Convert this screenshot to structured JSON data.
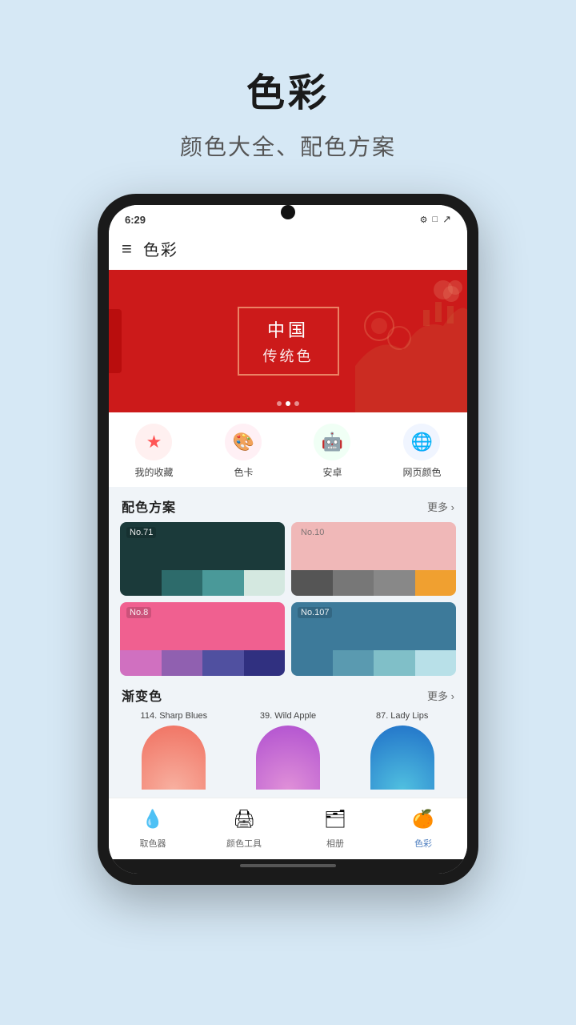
{
  "page": {
    "bg_color": "#d6e8f5",
    "main_title": "色彩",
    "subtitle": "颜色大全、配色方案"
  },
  "status_bar": {
    "time": "6:29",
    "icons": [
      "⚙",
      "□",
      "↗"
    ]
  },
  "nav": {
    "menu_icon": "≡",
    "title": "色彩"
  },
  "banner": {
    "title": "中国",
    "subtitle": "传统色",
    "dots": [
      false,
      true,
      false
    ]
  },
  "quick_items": [
    {
      "id": "favorites",
      "icon": "★",
      "icon_color": "#ff6b6b",
      "bg": "#fff0f0",
      "label": "我的收藏"
    },
    {
      "id": "color-card",
      "icon": "🎨",
      "icon_color": "#e05",
      "bg": "#fff0f5",
      "label": "色卡"
    },
    {
      "id": "android",
      "icon": "🤖",
      "icon_color": "#3ddc84",
      "bg": "#f0fff5",
      "label": "安卓"
    },
    {
      "id": "web-colors",
      "icon": "🌐",
      "icon_color": "#4285f4",
      "bg": "#f0f5ff",
      "label": "网页颜色"
    }
  ],
  "palette_section": {
    "title": "配色方案",
    "more_label": "更多",
    "palettes": [
      {
        "no": "No.71",
        "no_dark": false,
        "top_color": "#1b3a3a",
        "swatches": [
          "#1b3a3a",
          "#2d6b6b",
          "#4a9999",
          "#d4e8e0"
        ]
      },
      {
        "no": "No.10",
        "no_dark": true,
        "top_color": "#f0b8b8",
        "swatches": [
          "#555",
          "#777",
          "#888",
          "#f0a030"
        ]
      },
      {
        "no": "No.8",
        "no_dark": false,
        "top_color": "#f06090",
        "swatches": [
          "#d070c0",
          "#9060b0",
          "#5050a0",
          "#303080"
        ]
      },
      {
        "no": "No.107",
        "no_dark": false,
        "top_color": "#3d7a9a",
        "swatches": [
          "#3d7a9a",
          "#5a9ab0",
          "#80bfc8",
          "#b8e0e8"
        ]
      }
    ]
  },
  "gradient_section": {
    "title": "渐变色",
    "more_label": "更多",
    "gradients": [
      {
        "id": "sharp-blues",
        "label": "114. Sharp Blues",
        "color_start": "#f08080",
        "color_end": "#f8c0a0"
      },
      {
        "id": "wild-apple",
        "label": "39. Wild Apple",
        "color_start": "#c060e0",
        "color_end": "#e080d0"
      },
      {
        "id": "lady-lips",
        "label": "87. Lady Lips",
        "color_start": "#2080d0",
        "color_end": "#40b0e0"
      }
    ]
  },
  "bottom_nav": [
    {
      "id": "color-picker",
      "icon": "💧",
      "label": "取色器",
      "active": false
    },
    {
      "id": "color-tools",
      "icon": "🖨",
      "label": "颜色工具",
      "active": false
    },
    {
      "id": "album",
      "icon": "🗂",
      "label": "相册",
      "active": false
    },
    {
      "id": "colors",
      "icon": "🍊",
      "label": "色彩",
      "active": true
    }
  ]
}
